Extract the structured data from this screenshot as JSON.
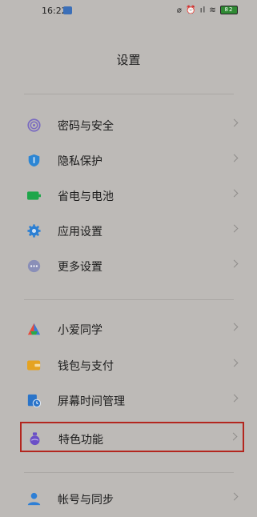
{
  "status_bar": {
    "time": "16:22",
    "indicators": "⌀ ⏰ ıl ≋",
    "battery": "82"
  },
  "title": "设置",
  "sections": [
    [
      {
        "label": "密码与安全",
        "icon": "fingerprint-icon",
        "color": "#7a6bc0"
      },
      {
        "label": "隐私保护",
        "icon": "shield-icon",
        "color": "#2c86d4"
      },
      {
        "label": "省电与电池",
        "icon": "battery-icon",
        "color": "#1ea64a"
      },
      {
        "label": "应用设置",
        "icon": "gear-icon",
        "color": "#2b7fd3"
      },
      {
        "label": "更多设置",
        "icon": "more-dots-icon",
        "color": "#8a8fb8"
      }
    ],
    [
      {
        "label": "小爱同学",
        "icon": "xiaoai-icon",
        "color": "#e84a3a"
      },
      {
        "label": "钱包与支付",
        "icon": "wallet-icon",
        "color": "#e5a321"
      },
      {
        "label": "屏幕时间管理",
        "icon": "screen-time-icon",
        "color": "#2a74c9"
      },
      {
        "label": "特色功能",
        "icon": "potion-icon",
        "color": "#6a4fc7"
      }
    ],
    [
      {
        "label": "帐号与同步",
        "icon": "account-icon",
        "color": "#2d7fd6"
      }
    ]
  ]
}
